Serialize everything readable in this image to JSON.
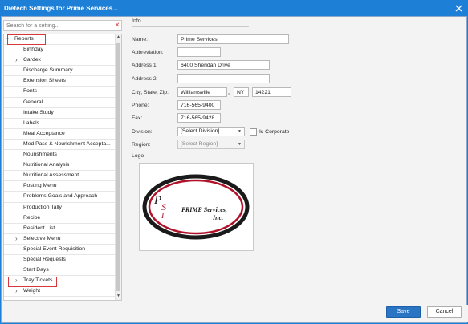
{
  "window": {
    "title": "Dietech Settings for Prime Services..."
  },
  "search": {
    "placeholder": "Search for a setting..."
  },
  "tree": {
    "root_label": "Reports",
    "items": [
      {
        "label": "Birthday",
        "expandable": false
      },
      {
        "label": "Cardex",
        "expandable": true
      },
      {
        "label": "Discharge Summary",
        "expandable": false
      },
      {
        "label": "Extension Sheets",
        "expandable": false
      },
      {
        "label": "Fonts",
        "expandable": false
      },
      {
        "label": "General",
        "expandable": false
      },
      {
        "label": "Intake Study",
        "expandable": false
      },
      {
        "label": "Labels",
        "expandable": false
      },
      {
        "label": "Meal Acceptance",
        "expandable": false
      },
      {
        "label": "Med Pass & Nourishment Accepta...",
        "expandable": false
      },
      {
        "label": "Nourishments",
        "expandable": false
      },
      {
        "label": "Nutritional Analysis",
        "expandable": false
      },
      {
        "label": "Nutritional Assessment",
        "expandable": false
      },
      {
        "label": "Posting Menu",
        "expandable": false
      },
      {
        "label": "Problems Goals and Approach",
        "expandable": false
      },
      {
        "label": "Production Tally",
        "expandable": false
      },
      {
        "label": "Recipe",
        "expandable": false
      },
      {
        "label": "Resident List",
        "expandable": false
      },
      {
        "label": "Selective Menu",
        "expandable": true
      },
      {
        "label": "Special Event Requisition",
        "expandable": false
      },
      {
        "label": "Special Requests",
        "expandable": false
      },
      {
        "label": "Start Days",
        "expandable": false
      },
      {
        "label": "Tray Tickets",
        "expandable": true
      },
      {
        "label": "Weight",
        "expandable": true
      }
    ],
    "partial_last": "Weight"
  },
  "info": {
    "section_title": "Info",
    "name_label": "Name:",
    "name_value": "Prime Services",
    "abbreviation_label": "Abbreviation:",
    "abbreviation_value": "",
    "address1_label": "Address 1:",
    "address1_value": "6400 Sheridan Drive",
    "address2_label": "Address 2:",
    "address2_value": "",
    "city_label": "City, State, Zip:",
    "city_value": "Williamsville",
    "comma": ",",
    "state_value": "NY",
    "zip_value": "14221",
    "phone_label": "Phone:",
    "phone_value": "716-565-9400",
    "fax_label": "Fax:",
    "fax_value": "716-565-9428",
    "division_label": "Division:",
    "division_value": "[Select Division]",
    "is_corporate_label": "Is Corporate",
    "region_label": "Region:",
    "region_value": "[Select Region]",
    "logo_label": "Logo"
  },
  "logo": {
    "letters": "PSI",
    "letter_p": "P",
    "letter_s": "S",
    "letter_i": "I",
    "line1": "PRIME Services,",
    "line2": "Inc.",
    "colors": {
      "ring_dark": "#1a1a1a",
      "ring_red": "#b0122a"
    }
  },
  "footer": {
    "save_label": "Save",
    "cancel_label": "Cancel"
  },
  "colors": {
    "titlebar": "#1e7fd6",
    "highlight": "#d9383a",
    "primary_button": "#2a74c4"
  }
}
